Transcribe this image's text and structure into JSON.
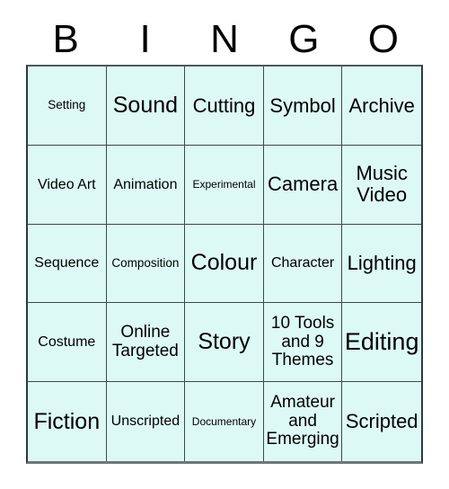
{
  "card": {
    "title": "BINGO Card",
    "columns": [
      "B",
      "I",
      "N",
      "G",
      "O"
    ],
    "colors": {
      "cell_background": "#ddf9f5",
      "border": "#3a4a4a",
      "text": "#000000",
      "page_background": "#ffffff"
    },
    "cells": [
      {
        "text": "Setting",
        "size": "sz-s"
      },
      {
        "text": "Sound",
        "size": "sz-xxl"
      },
      {
        "text": "Cutting",
        "size": "sz-xl"
      },
      {
        "text": "Symbol",
        "size": "sz-xl"
      },
      {
        "text": "Archive",
        "size": "sz-xl"
      },
      {
        "text": "Video Art",
        "size": "sz-m"
      },
      {
        "text": "Animation",
        "size": "sz-m"
      },
      {
        "text": "Experimental",
        "size": "sz-xs"
      },
      {
        "text": "Camera",
        "size": "sz-xl"
      },
      {
        "text": "Music Video",
        "size": "sz-xl"
      },
      {
        "text": "Sequence",
        "size": "sz-m"
      },
      {
        "text": "Composition",
        "size": "sz-s"
      },
      {
        "text": "Colour",
        "size": "sz-xxl"
      },
      {
        "text": "Character",
        "size": "sz-m"
      },
      {
        "text": "Lighting",
        "size": "sz-xl"
      },
      {
        "text": "Costume",
        "size": "sz-m"
      },
      {
        "text": "Online Targeted",
        "size": "sz-l"
      },
      {
        "text": "Story",
        "size": "sz-xxl"
      },
      {
        "text": "10 Tools and 9 Themes",
        "size": "sz-l"
      },
      {
        "text": "Editing",
        "size": "sz-xxxl"
      },
      {
        "text": "Fiction",
        "size": "sz-xxl"
      },
      {
        "text": "Unscripted",
        "size": "sz-m"
      },
      {
        "text": "Documentary",
        "size": "sz-xs"
      },
      {
        "text": "Amateur and Emerging",
        "size": "sz-l"
      },
      {
        "text": "Scripted",
        "size": "sz-xl"
      }
    ]
  }
}
